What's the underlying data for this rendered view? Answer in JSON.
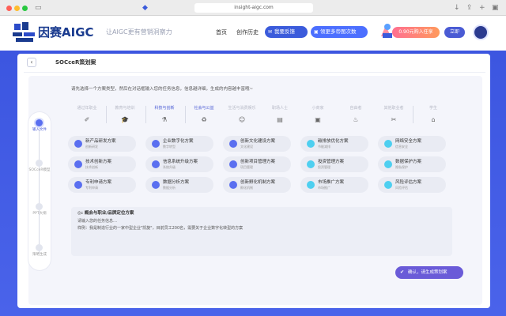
{
  "browser": {
    "url": "insight-aigc.com"
  },
  "header": {
    "brand": "因赛AIGC",
    "slogan": "让AIGC更有营销洞察力",
    "nav": [
      "首页",
      "创作历史"
    ],
    "feedback_label": "我要反馈",
    "free_label": "领更多帝图次数",
    "promo_label": "0.90元购入任享",
    "promo_badge": "立即"
  },
  "page": {
    "title": "SOCceR策划案",
    "instruction": "请先选择一个方案类型，然后在对话框输入您的任务信息，信息越详细，生成的内容越丰富哦~"
  },
  "steps": [
    {
      "label": "输入文件",
      "active": true
    },
    {
      "label": "SOCceR模型",
      "active": false
    },
    {
      "label": "PPT大纲",
      "active": false
    },
    {
      "label": "策略生成",
      "active": false
    }
  ],
  "tabs": [
    {
      "label": "通过年职业",
      "icon": "✐",
      "selected": false
    },
    {
      "label": "教育与培训",
      "icon": "🎓",
      "selected": false
    },
    {
      "label": "科技与创新",
      "icon": "⚗",
      "selected": true
    },
    {
      "label": "社会与公益",
      "icon": "♻",
      "selected": true
    },
    {
      "label": "生活与消费娱乐",
      "icon": "☺",
      "selected": false
    },
    {
      "label": "职场人士",
      "icon": "▤",
      "selected": false
    },
    {
      "label": "小商家",
      "icon": "▣",
      "selected": false
    },
    {
      "label": "自由者",
      "icon": "♨",
      "selected": false
    },
    {
      "label": "其他职业者",
      "icon": "✂",
      "selected": false
    },
    {
      "label": "学生",
      "icon": "⌂",
      "selected": false
    }
  ],
  "cards": [
    {
      "title": "新产品研发方案",
      "sub": "创新研发",
      "cyan": false
    },
    {
      "title": "企业数字化方案",
      "sub": "数字转型",
      "cyan": false
    },
    {
      "title": "创新文化建设方案",
      "sub": "文化建设",
      "cyan": false
    },
    {
      "title": "碳排放优化方案",
      "sub": "节能减排",
      "cyan": true
    },
    {
      "title": "网络安全方案",
      "sub": "信息安全",
      "cyan": true
    },
    {
      "title": "技术创新方案",
      "sub": "技术创新",
      "cyan": false
    },
    {
      "title": "信息系统升级方案",
      "sub": "系统升级",
      "cyan": false
    },
    {
      "title": "创新项目管理方案",
      "sub": "项目管理",
      "cyan": false
    },
    {
      "title": "投资管理方案",
      "sub": "投资管理",
      "cyan": true
    },
    {
      "title": "数据保护方案",
      "sub": "隐私保护",
      "cyan": true
    },
    {
      "title": "专利申请方案",
      "sub": "专利申请",
      "cyan": false
    },
    {
      "title": "数据分析方案",
      "sub": "数据分析",
      "cyan": false
    },
    {
      "title": "创新孵化机制方案",
      "sub": "孵化机制",
      "cyan": false
    },
    {
      "title": "市场推广方案",
      "sub": "市场推广",
      "cyan": true
    },
    {
      "title": "风险评估方案",
      "sub": "风险评估",
      "cyan": true
    }
  ],
  "selected_plan": {
    "title": "◎: 概会与职业/品牌定位方案",
    "hint": "请输入您的任务信息…",
    "example": "样例：我是制造行业的一家中型企业\"凯旋\"，目前员工200名，需要关于企业数字化转型的方案"
  },
  "confirm_label": "确认，请生成策划案",
  "colors": {
    "accent": "#3c56e0",
    "confirm": "#6a5bd8",
    "dot_blue": "#5a6ff0",
    "dot_cyan": "#4ecff0"
  }
}
